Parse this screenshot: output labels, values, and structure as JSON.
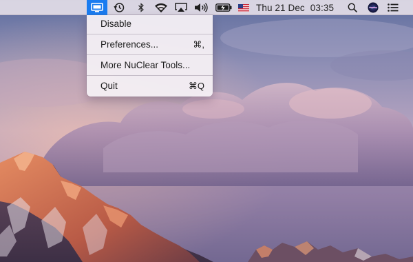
{
  "menubar": {
    "clock_day": "Thu 21 Dec",
    "clock_time": "03:35",
    "icons": [
      "display-icon",
      "time-machine-icon",
      "bluetooth-icon",
      "wifi-icon",
      "airplay-icon",
      "volume-icon",
      "battery-icon",
      "us-flag-icon",
      "search-icon",
      "siri-icon",
      "notification-center-icon"
    ]
  },
  "menu": {
    "disable_label": "Disable",
    "preferences_label": "Preferences...",
    "preferences_shortcut": "⌘,",
    "more_tools_label": "More NuClear Tools...",
    "quit_label": "Quit",
    "quit_shortcut": "⌘Q"
  },
  "colors": {
    "accent": "#1a7cf0",
    "sky_top": "#5d6fa0",
    "sky_mid": "#b6a3c0",
    "mountain_lit": "#d97a55"
  }
}
